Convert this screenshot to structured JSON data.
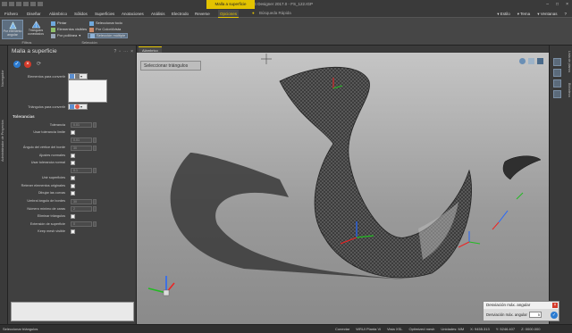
{
  "app": {
    "title": "HOMAG Designer 2017.0 - FS_122.IGP",
    "context_tab": "Malla a superficie"
  },
  "ribbon_tabs": [
    "Fichero",
    "Diseñar",
    "Alámbrico",
    "Sólidos",
    "Superficies",
    "Anotaciones",
    "Análisis",
    "Electrodo",
    "Reverse",
    "Opciones"
  ],
  "active_tab": "Opciones",
  "search": {
    "placeholder": "Búsqueda Rápida"
  },
  "topright": [
    "Estilo",
    "Tema",
    "Ventanas"
  ],
  "ribbon": {
    "group_left_label": "Filtros",
    "group_sel_label": "Selección",
    "big_buttons": [
      "Por elemento angular",
      "Triángulos conectados"
    ],
    "mid_buttons": [
      "Pintar",
      "Elementos visibles",
      "Por polilínea"
    ],
    "sel_buttons": [
      "Seleccionar todo",
      "Por Color/Arista",
      "Selección múltiple"
    ]
  },
  "panel": {
    "title": "Malla a superficie",
    "left_tabs": [
      "Navegador",
      "Administrador de Proyectos"
    ],
    "field_elements": "Elementos para convertir",
    "field_triangles": "Triángulos para convertir",
    "section": "Tolerancias",
    "rows": [
      {
        "label": "Tolerancia",
        "value": "0.01",
        "kind": "num"
      },
      {
        "label": "Usar tolerancia límite",
        "kind": "check"
      },
      {
        "label": "",
        "value": "0.01",
        "kind": "num"
      },
      {
        "label": "Ángulo del vértice del borde",
        "value": "30",
        "kind": "num"
      },
      {
        "label": "Ajustes normales",
        "kind": "check"
      },
      {
        "label": "Usar tolerancia normal",
        "kind": "check"
      },
      {
        "label": "",
        "value": "0.1",
        "kind": "num"
      },
      {
        "label": "Unir superficies",
        "kind": "check"
      },
      {
        "label": "Retener elementos originales",
        "kind": "check"
      },
      {
        "label": "Dibujar las curvas",
        "kind": "check"
      },
      {
        "label": "Umbral ángulo de bordes",
        "value": "30",
        "kind": "num"
      },
      {
        "label": "Número mínimo de caras",
        "value": "2",
        "kind": "num"
      },
      {
        "label": "Eliminar triángulos",
        "kind": "check"
      },
      {
        "label": "Extensión de superficie",
        "value": "0",
        "kind": "num"
      },
      {
        "label": "Keep mesh visible",
        "kind": "check"
      }
    ]
  },
  "viewport": {
    "tab": "Alámbrico",
    "overlay": "Seleccionar triángulos"
  },
  "right_tabs": [
    "Lista de planos",
    "Biblioteca"
  ],
  "dialog": {
    "title": "Desviación máx. angular",
    "label": "Desviación máx. angular",
    "value": "5"
  },
  "status": {
    "left": "Seleccionar triángulos",
    "right": [
      "Conectar",
      "WRUI Planta Vi",
      "Vista XSL",
      "Optimized mesh",
      "Unidades: MM",
      "X: 9455.313",
      "Y: 5246.407",
      "Z: 0000.000"
    ]
  }
}
